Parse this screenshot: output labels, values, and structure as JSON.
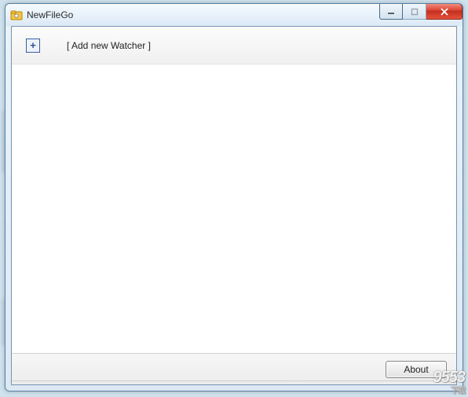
{
  "window": {
    "title": "NewFileGo"
  },
  "main": {
    "add_watcher_label": "[ Add new Watcher ]"
  },
  "footer": {
    "about_label": "About"
  },
  "watermark": {
    "text": "9553",
    "sub": "下载"
  }
}
